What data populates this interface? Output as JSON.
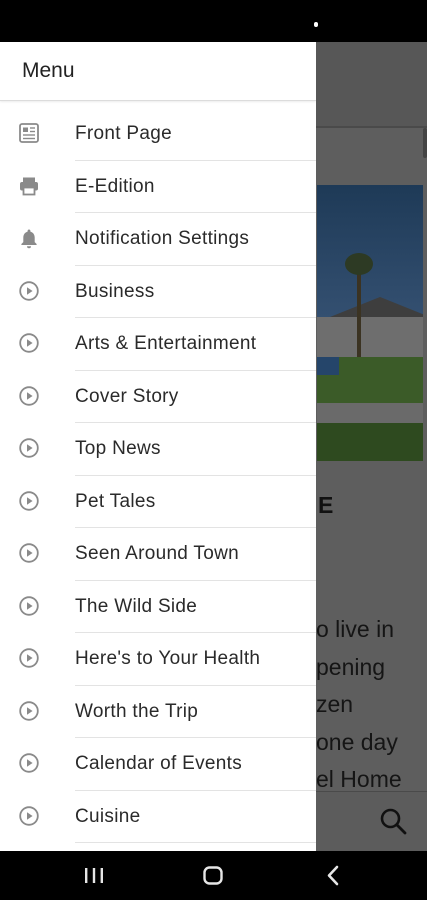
{
  "drawer": {
    "title": "Menu",
    "items": [
      {
        "label": "Front Page",
        "icon": "newspaper-icon"
      },
      {
        "label": "E-Edition",
        "icon": "printer-icon"
      },
      {
        "label": "Notification Settings",
        "icon": "bell-icon"
      },
      {
        "label": "Business",
        "icon": "play-circle-icon"
      },
      {
        "label": "Arts & Entertainment",
        "icon": "play-circle-icon"
      },
      {
        "label": "Cover Story",
        "icon": "play-circle-icon"
      },
      {
        "label": "Top News",
        "icon": "play-circle-icon"
      },
      {
        "label": "Pet Tales",
        "icon": "play-circle-icon"
      },
      {
        "label": "Seen Around Town",
        "icon": "play-circle-icon"
      },
      {
        "label": "The Wild Side",
        "icon": "play-circle-icon"
      },
      {
        "label": "Here's to Your Health",
        "icon": "play-circle-icon"
      },
      {
        "label": "Worth the Trip",
        "icon": "play-circle-icon"
      },
      {
        "label": "Calendar of Events",
        "icon": "play-circle-icon"
      },
      {
        "label": "Cuisine",
        "icon": "play-circle-icon"
      }
    ]
  },
  "background_article": {
    "title_fragment": "E",
    "body_fragments": [
      "o live in",
      "pening",
      "zen",
      "one day",
      "el Home"
    ]
  },
  "navbar": {
    "buttons": [
      {
        "icon": "recent-apps-icon"
      },
      {
        "icon": "home-icon"
      },
      {
        "icon": "back-icon"
      }
    ]
  }
}
